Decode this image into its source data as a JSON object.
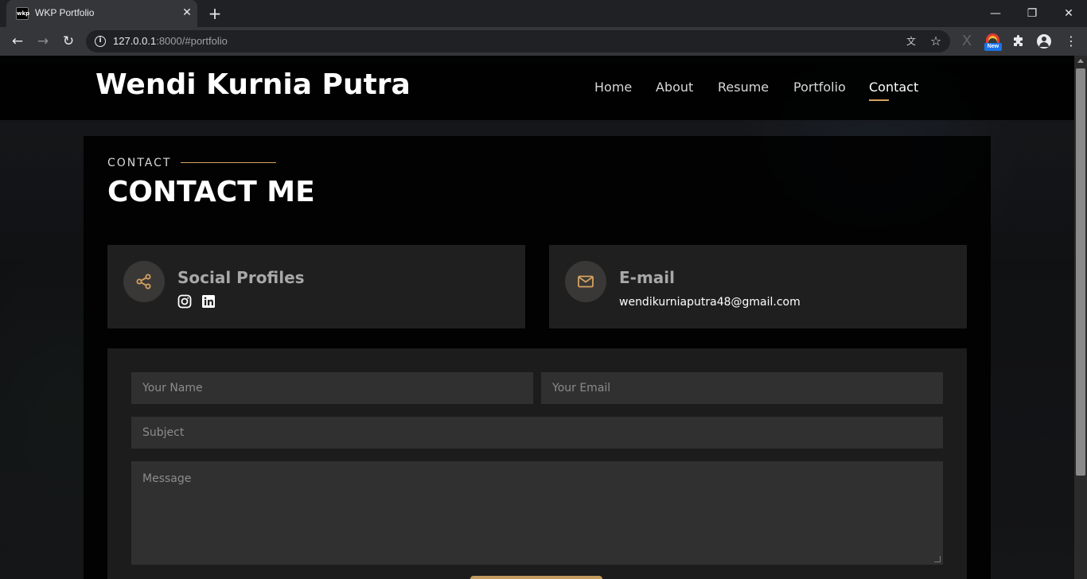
{
  "browser": {
    "tab_title": "WKP Portfolio",
    "tab_favicon_text": "wkp",
    "url_host": "127.0.0.1",
    "url_path": ":8000/#portfolio",
    "extension_badge": "New"
  },
  "site": {
    "logo": "Wendi Kurnia Putra",
    "nav": [
      "Home",
      "About",
      "Resume",
      "Portfolio",
      "Contact"
    ],
    "active_nav": "Contact"
  },
  "contact": {
    "kicker": "CONTACT",
    "title": "CONTACT ME",
    "social_title": "Social Profiles",
    "email_title": "E-mail",
    "email": "wendikurniaputra48@gmail.com"
  },
  "form": {
    "name_placeholder": "Your Name",
    "email_placeholder": "Your Email",
    "subject_placeholder": "Subject",
    "message_placeholder": "Message"
  },
  "colors": {
    "accent": "#d4a261",
    "header_bg": "#000000"
  },
  "icons": {
    "social": [
      "instagram-icon",
      "linkedin-icon"
    ],
    "social_box": "share-icon",
    "email_box": "envelope-icon"
  }
}
